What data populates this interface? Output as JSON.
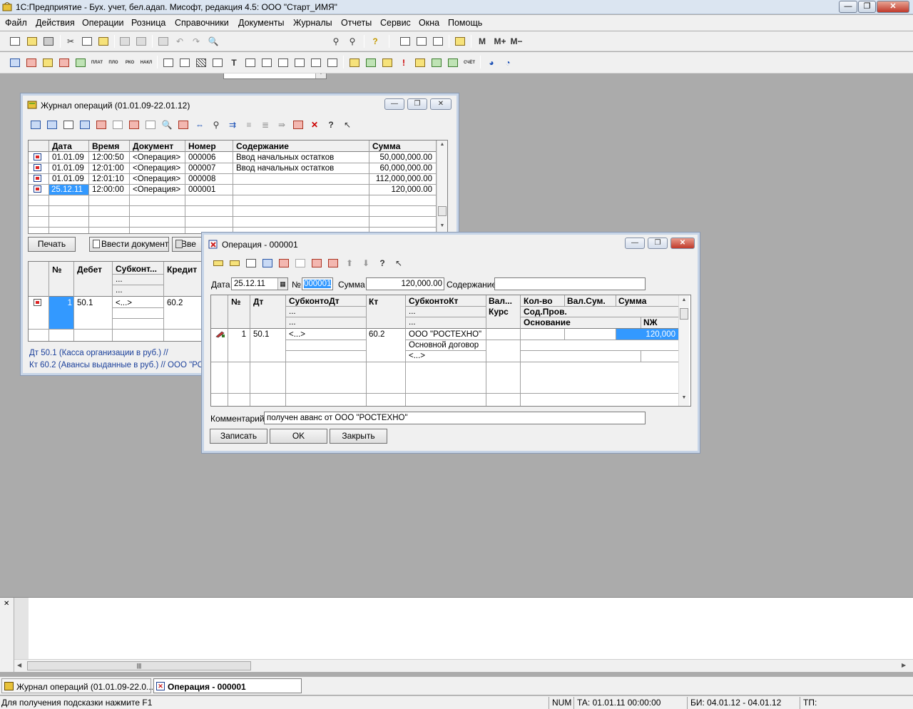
{
  "app": {
    "title": "1С:Предприятие - Бух. учет, бел.адап. Мисофт, редакция 4.5: ООО \"Старт_ИМЯ\""
  },
  "menu": [
    "Файл",
    "Действия",
    "Операции",
    "Розница",
    "Справочники",
    "Документы",
    "Журналы",
    "Отчеты",
    "Сервис",
    "Окна",
    "Помощь"
  ],
  "toolbar": {
    "m_label": "M",
    "m_plus_label": "M+",
    "m_minus_label": "M−",
    "mini_labels": [
      "ПЛАТ",
      "ПЛО",
      "РКО",
      "НАКЛ",
      "СЧЁТ"
    ]
  },
  "journal": {
    "title": "Журнал операций  (01.01.09-22.01.12)",
    "columns": [
      "Дата",
      "Время",
      "Документ",
      "Номер",
      "Содержание",
      "Сумма"
    ],
    "rows": [
      {
        "date": "01.01.09",
        "time": "12:00:50",
        "doc": "<Операция>",
        "num": "000006",
        "content": "Ввод начальных остатков",
        "sum": "50,000,000.00"
      },
      {
        "date": "01.01.09",
        "time": "12:01:00",
        "doc": "<Операция>",
        "num": "000007",
        "content": "Ввод начальных остатков",
        "sum": "60,000,000.00"
      },
      {
        "date": "01.01.09",
        "time": "12:01:10",
        "doc": "<Операция>",
        "num": "000008",
        "content": "",
        "sum": "112,000,000.00"
      },
      {
        "date": "25.12.11",
        "time": "12:00:00",
        "doc": "<Операция>",
        "num": "000001",
        "content": "",
        "sum": "120,000.00"
      }
    ],
    "btn_print": "Печать",
    "btn_enter_doc": "Ввести документ",
    "btn_enter2": "Вве",
    "lower_columns": [
      "№",
      "Дебет",
      "Субконт...",
      "Кредит"
    ],
    "lower_row": {
      "n": "1",
      "debit": "50.1",
      "sub": "<...>",
      "credit": "60.2"
    },
    "dots": "...",
    "footer_dt": "Дт 50.1 (Касса организации в руб.) //",
    "footer_kt": "Кт 60.2 (Авансы выданные в руб.) // ООО \"РОС"
  },
  "operation": {
    "title": "Операция - 000001",
    "date_label": "Дата",
    "date_value": "25.12.11",
    "num_label": "№",
    "num_value": "000001",
    "sum_label": "Сумма",
    "sum_value": "120,000.00",
    "content_label": "Содержание",
    "content_value": "",
    "headers": {
      "n": "№",
      "dt": "Дт",
      "subdt": "СубконтоДт",
      "kt": "Кт",
      "subkt": "СубконтоКт",
      "val": "Вал...",
      "kurs": "Курс",
      "qty": "Кол-во",
      "valsum": "Вал.Сум.",
      "sum": "Сумма",
      "sodprov": "Сод.Пров.",
      "osnovanie": "Основание",
      "nzh": "NЖ",
      "dots": "..."
    },
    "row": {
      "n": "1",
      "dt": "50.1",
      "subdt": "<...>",
      "kt": "60.2",
      "subkt1": "ООО \"РОСТЕХНО\"",
      "subkt2": "Основной договор",
      "subkt3": "<...>",
      "sum": "120,000"
    },
    "comment_label": "Комментарий:",
    "comment_value": "получен аванс от ООО \"РОСТЕХНО\"",
    "btn_save": "Записать",
    "btn_ok": "OK",
    "btn_close": "Закрыть"
  },
  "taskbar": {
    "item1": "Журнал операций  (01.01.09-22.0...",
    "item2": "Операция - 000001"
  },
  "status": {
    "hint": "Для получения подсказки нажмите F1",
    "num": "NUM",
    "ta": "ТА: 01.01.11  00:00:00",
    "bi": "БИ: 04.01.12 - 04.01.12",
    "tp": "ТП:"
  },
  "colors": {
    "accent": "#3399ff",
    "workspace": "#ababab"
  }
}
